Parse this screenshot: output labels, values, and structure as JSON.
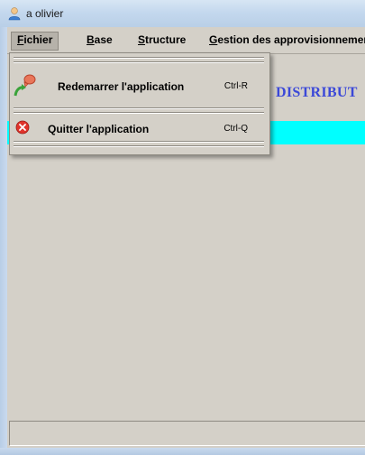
{
  "window": {
    "title": "a olivier"
  },
  "menubar": {
    "items": [
      {
        "label": "Fichier"
      },
      {
        "label": "Base"
      },
      {
        "label": "Structure"
      },
      {
        "label": "Gestion des approvisionnemen"
      }
    ]
  },
  "dropdown": {
    "items": [
      {
        "label": "Redemarrer l'application",
        "shortcut": "Ctrl-R",
        "icon": "restart-icon"
      },
      {
        "label": "Quitter l'application",
        "shortcut": "Ctrl-Q",
        "icon": "close-icon"
      }
    ]
  },
  "content": {
    "heading": "DISTRIBUT"
  },
  "colors": {
    "heading": "#3b48d8",
    "band": "#00ffff"
  }
}
